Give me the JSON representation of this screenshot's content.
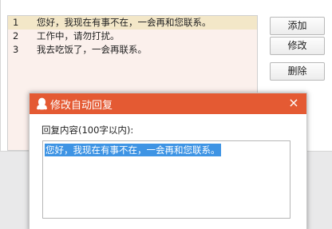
{
  "reply_list": {
    "rows": [
      {
        "num": "1",
        "text": "您好，我现在有事不在，一会再和您联系。"
      },
      {
        "num": "2",
        "text": "工作中，请勿打扰。"
      },
      {
        "num": "3",
        "text": "我去吃饭了，一会再联系。"
      }
    ]
  },
  "buttons": {
    "add": "添加",
    "edit": "修改",
    "delete": "删除"
  },
  "modal": {
    "title": "修改自动回复",
    "close": "×",
    "field_label": "回复内容(100字以内):",
    "content_value": "您好，我现在有事不在，一会再和您联系。",
    "icon": "qq-penguin-icon",
    "titlebar_color": "#e45a33",
    "selection_color": "#3e94e4"
  }
}
